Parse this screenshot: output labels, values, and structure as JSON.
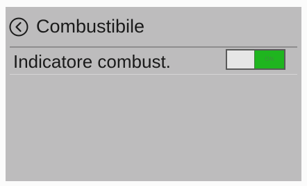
{
  "header": {
    "back_icon": "chevron-left-circle-icon",
    "title": "Combustibile"
  },
  "settings": {
    "fuel_indicator": {
      "label": "Indicatore combust.",
      "toggle_state_label": "ON",
      "enabled": true
    }
  },
  "colors": {
    "screen_background": "#bdbcbd",
    "toggle_on": "#1fb51f",
    "toggle_off": "#e6e6e6"
  }
}
